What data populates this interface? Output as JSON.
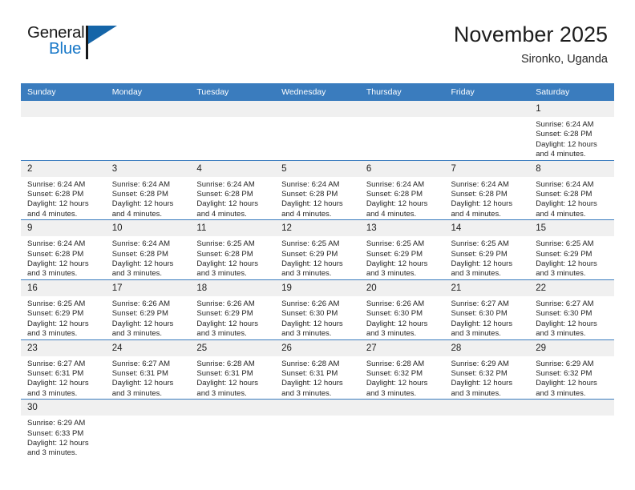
{
  "logo": {
    "word_general": "General",
    "word_blue": "Blue",
    "flag_color": "#1565a8"
  },
  "header": {
    "title": "November 2025",
    "subtitle": "Sironko, Uganda"
  },
  "colors": {
    "header_blue": "#3a7cbe",
    "daynum_bg": "#f0f0f0",
    "text": "#262626"
  },
  "weekdays": [
    "Sunday",
    "Monday",
    "Tuesday",
    "Wednesday",
    "Thursday",
    "Friday",
    "Saturday"
  ],
  "labels": {
    "sunrise": "Sunrise:",
    "sunset": "Sunset:",
    "daylight": "Daylight:"
  },
  "weeks": [
    [
      {
        "day": "",
        "empty": true
      },
      {
        "day": "",
        "empty": true
      },
      {
        "day": "",
        "empty": true
      },
      {
        "day": "",
        "empty": true
      },
      {
        "day": "",
        "empty": true
      },
      {
        "day": "",
        "empty": true
      },
      {
        "day": "1",
        "sunrise": "Sunrise: 6:24 AM",
        "sunset": "Sunset: 6:28 PM",
        "daylight": "Daylight: 12 hours and 4 minutes."
      }
    ],
    [
      {
        "day": "2",
        "sunrise": "Sunrise: 6:24 AM",
        "sunset": "Sunset: 6:28 PM",
        "daylight": "Daylight: 12 hours and 4 minutes."
      },
      {
        "day": "3",
        "sunrise": "Sunrise: 6:24 AM",
        "sunset": "Sunset: 6:28 PM",
        "daylight": "Daylight: 12 hours and 4 minutes."
      },
      {
        "day": "4",
        "sunrise": "Sunrise: 6:24 AM",
        "sunset": "Sunset: 6:28 PM",
        "daylight": "Daylight: 12 hours and 4 minutes."
      },
      {
        "day": "5",
        "sunrise": "Sunrise: 6:24 AM",
        "sunset": "Sunset: 6:28 PM",
        "daylight": "Daylight: 12 hours and 4 minutes."
      },
      {
        "day": "6",
        "sunrise": "Sunrise: 6:24 AM",
        "sunset": "Sunset: 6:28 PM",
        "daylight": "Daylight: 12 hours and 4 minutes."
      },
      {
        "day": "7",
        "sunrise": "Sunrise: 6:24 AM",
        "sunset": "Sunset: 6:28 PM",
        "daylight": "Daylight: 12 hours and 4 minutes."
      },
      {
        "day": "8",
        "sunrise": "Sunrise: 6:24 AM",
        "sunset": "Sunset: 6:28 PM",
        "daylight": "Daylight: 12 hours and 4 minutes."
      }
    ],
    [
      {
        "day": "9",
        "sunrise": "Sunrise: 6:24 AM",
        "sunset": "Sunset: 6:28 PM",
        "daylight": "Daylight: 12 hours and 3 minutes."
      },
      {
        "day": "10",
        "sunrise": "Sunrise: 6:24 AM",
        "sunset": "Sunset: 6:28 PM",
        "daylight": "Daylight: 12 hours and 3 minutes."
      },
      {
        "day": "11",
        "sunrise": "Sunrise: 6:25 AM",
        "sunset": "Sunset: 6:28 PM",
        "daylight": "Daylight: 12 hours and 3 minutes."
      },
      {
        "day": "12",
        "sunrise": "Sunrise: 6:25 AM",
        "sunset": "Sunset: 6:29 PM",
        "daylight": "Daylight: 12 hours and 3 minutes."
      },
      {
        "day": "13",
        "sunrise": "Sunrise: 6:25 AM",
        "sunset": "Sunset: 6:29 PM",
        "daylight": "Daylight: 12 hours and 3 minutes."
      },
      {
        "day": "14",
        "sunrise": "Sunrise: 6:25 AM",
        "sunset": "Sunset: 6:29 PM",
        "daylight": "Daylight: 12 hours and 3 minutes."
      },
      {
        "day": "15",
        "sunrise": "Sunrise: 6:25 AM",
        "sunset": "Sunset: 6:29 PM",
        "daylight": "Daylight: 12 hours and 3 minutes."
      }
    ],
    [
      {
        "day": "16",
        "sunrise": "Sunrise: 6:25 AM",
        "sunset": "Sunset: 6:29 PM",
        "daylight": "Daylight: 12 hours and 3 minutes."
      },
      {
        "day": "17",
        "sunrise": "Sunrise: 6:26 AM",
        "sunset": "Sunset: 6:29 PM",
        "daylight": "Daylight: 12 hours and 3 minutes."
      },
      {
        "day": "18",
        "sunrise": "Sunrise: 6:26 AM",
        "sunset": "Sunset: 6:29 PM",
        "daylight": "Daylight: 12 hours and 3 minutes."
      },
      {
        "day": "19",
        "sunrise": "Sunrise: 6:26 AM",
        "sunset": "Sunset: 6:30 PM",
        "daylight": "Daylight: 12 hours and 3 minutes."
      },
      {
        "day": "20",
        "sunrise": "Sunrise: 6:26 AM",
        "sunset": "Sunset: 6:30 PM",
        "daylight": "Daylight: 12 hours and 3 minutes."
      },
      {
        "day": "21",
        "sunrise": "Sunrise: 6:27 AM",
        "sunset": "Sunset: 6:30 PM",
        "daylight": "Daylight: 12 hours and 3 minutes."
      },
      {
        "day": "22",
        "sunrise": "Sunrise: 6:27 AM",
        "sunset": "Sunset: 6:30 PM",
        "daylight": "Daylight: 12 hours and 3 minutes."
      }
    ],
    [
      {
        "day": "23",
        "sunrise": "Sunrise: 6:27 AM",
        "sunset": "Sunset: 6:31 PM",
        "daylight": "Daylight: 12 hours and 3 minutes."
      },
      {
        "day": "24",
        "sunrise": "Sunrise: 6:27 AM",
        "sunset": "Sunset: 6:31 PM",
        "daylight": "Daylight: 12 hours and 3 minutes."
      },
      {
        "day": "25",
        "sunrise": "Sunrise: 6:28 AM",
        "sunset": "Sunset: 6:31 PM",
        "daylight": "Daylight: 12 hours and 3 minutes."
      },
      {
        "day": "26",
        "sunrise": "Sunrise: 6:28 AM",
        "sunset": "Sunset: 6:31 PM",
        "daylight": "Daylight: 12 hours and 3 minutes."
      },
      {
        "day": "27",
        "sunrise": "Sunrise: 6:28 AM",
        "sunset": "Sunset: 6:32 PM",
        "daylight": "Daylight: 12 hours and 3 minutes."
      },
      {
        "day": "28",
        "sunrise": "Sunrise: 6:29 AM",
        "sunset": "Sunset: 6:32 PM",
        "daylight": "Daylight: 12 hours and 3 minutes."
      },
      {
        "day": "29",
        "sunrise": "Sunrise: 6:29 AM",
        "sunset": "Sunset: 6:32 PM",
        "daylight": "Daylight: 12 hours and 3 minutes."
      }
    ],
    [
      {
        "day": "30",
        "sunrise": "Sunrise: 6:29 AM",
        "sunset": "Sunset: 6:33 PM",
        "daylight": "Daylight: 12 hours and 3 minutes."
      },
      {
        "day": "",
        "empty": true
      },
      {
        "day": "",
        "empty": true
      },
      {
        "day": "",
        "empty": true
      },
      {
        "day": "",
        "empty": true
      },
      {
        "day": "",
        "empty": true
      },
      {
        "day": "",
        "empty": true
      }
    ]
  ]
}
